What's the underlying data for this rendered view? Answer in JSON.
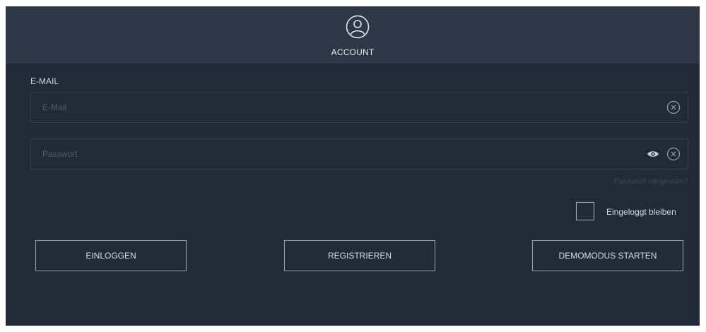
{
  "header": {
    "title": "ACCOUNT",
    "icon": "user-circle-icon"
  },
  "email": {
    "label": "E-MAIL",
    "placeholder": "E-Mail",
    "value": ""
  },
  "password": {
    "placeholder": "Passwort",
    "value": ""
  },
  "forgot_password": "Passwort vergessen?",
  "stay_logged_in": {
    "label": "Eingeloggt bleiben",
    "checked": false
  },
  "buttons": {
    "login": "EINLOGGEN",
    "register": "REGISTRIEREN",
    "demo": "DEMOMODUS STARTEN"
  },
  "colors": {
    "background": "#222a37",
    "header": "#2d3746",
    "text": "#d9dde3"
  }
}
